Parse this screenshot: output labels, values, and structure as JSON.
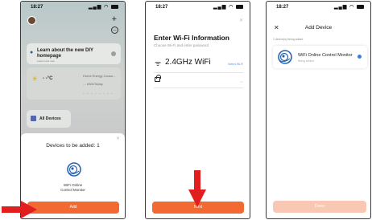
{
  "colors": {
    "accent": "#f26a32",
    "accent_disabled": "#f8c8b4",
    "arrow": "#e21f1f",
    "link": "#5b8fd9"
  },
  "screen1": {
    "time": "18:27",
    "learn_title": "Learn about the new DIY homepage",
    "learn_sub": "Learn more now",
    "temp": "- -°C",
    "energy_name": "Home Energy Consu...",
    "energy_value": "- - kWh/Today",
    "energy_dashes": "- - - - - - - -",
    "all_devices": "All Devices",
    "sheet_title": "Devices to be added: 1",
    "device_name_line1": "WiFi Online",
    "device_name_line2": "Control Monitor",
    "add_label": "Add"
  },
  "screen2": {
    "time": "18:27",
    "title": "Enter Wi-Fi Information",
    "subtitle": "Choose Wi-Fi and enter password",
    "ssid": "2.4GHz WiFi",
    "select_wifi": "Select Wi-Fi",
    "next_label": "Next"
  },
  "screen3": {
    "time": "18:27",
    "title": "Add Device",
    "adding_status": "1 device(s) being added",
    "device_name": "WiFi Online Control Monitor",
    "device_status": "Being added",
    "done_label": "Done"
  }
}
